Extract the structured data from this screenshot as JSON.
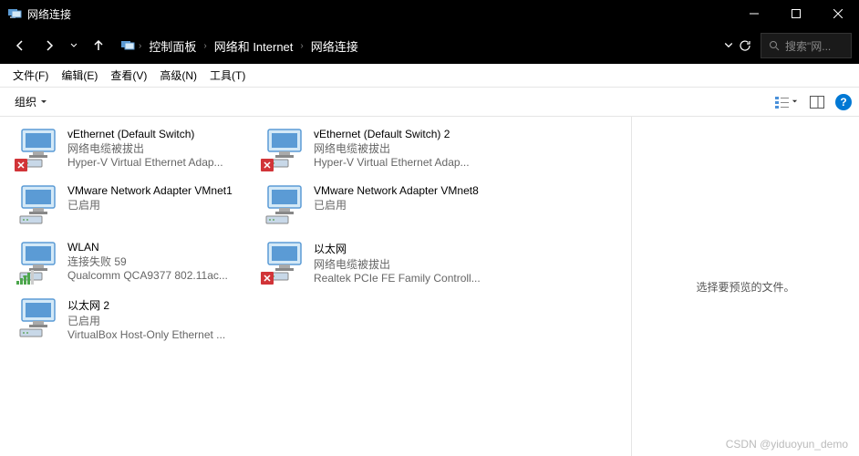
{
  "window": {
    "title": "网络连接"
  },
  "breadcrumb": {
    "items": [
      "控制面板",
      "网络和 Internet",
      "网络连接"
    ]
  },
  "search": {
    "placeholder": "搜索\"网..."
  },
  "menu": {
    "file": "文件(F)",
    "edit": "编辑(E)",
    "view": "查看(V)",
    "advanced": "高级(N)",
    "tools": "工具(T)"
  },
  "toolbar": {
    "organize": "组织"
  },
  "preview": {
    "empty": "选择要预览的文件。"
  },
  "connections": [
    {
      "name": "vEthernet (Default Switch)",
      "status": "网络电缆被拔出",
      "device": "Hyper-V Virtual Ethernet Adap...",
      "disconnected": true,
      "type": "ethernet"
    },
    {
      "name": "vEthernet (Default Switch) 2",
      "status": "网络电缆被拔出",
      "device": "Hyper-V Virtual Ethernet Adap...",
      "disconnected": true,
      "type": "ethernet"
    },
    {
      "name": "VMware Network Adapter VMnet1",
      "status": "已启用",
      "device": "",
      "disconnected": false,
      "type": "ethernet"
    },
    {
      "name": "VMware Network Adapter VMnet8",
      "status": "已启用",
      "device": "",
      "disconnected": false,
      "type": "ethernet"
    },
    {
      "name": "WLAN",
      "status": "连接失败 59",
      "device": "Qualcomm QCA9377 802.11ac...",
      "disconnected": false,
      "type": "wifi"
    },
    {
      "name": "以太网",
      "status": "网络电缆被拔出",
      "device": "Realtek PCIe FE Family Controll...",
      "disconnected": true,
      "type": "ethernet"
    },
    {
      "name": "以太网 2",
      "status": "已启用",
      "device": "VirtualBox Host-Only Ethernet ...",
      "disconnected": false,
      "type": "ethernet"
    }
  ],
  "watermark": "CSDN @yiduoyun_demo"
}
